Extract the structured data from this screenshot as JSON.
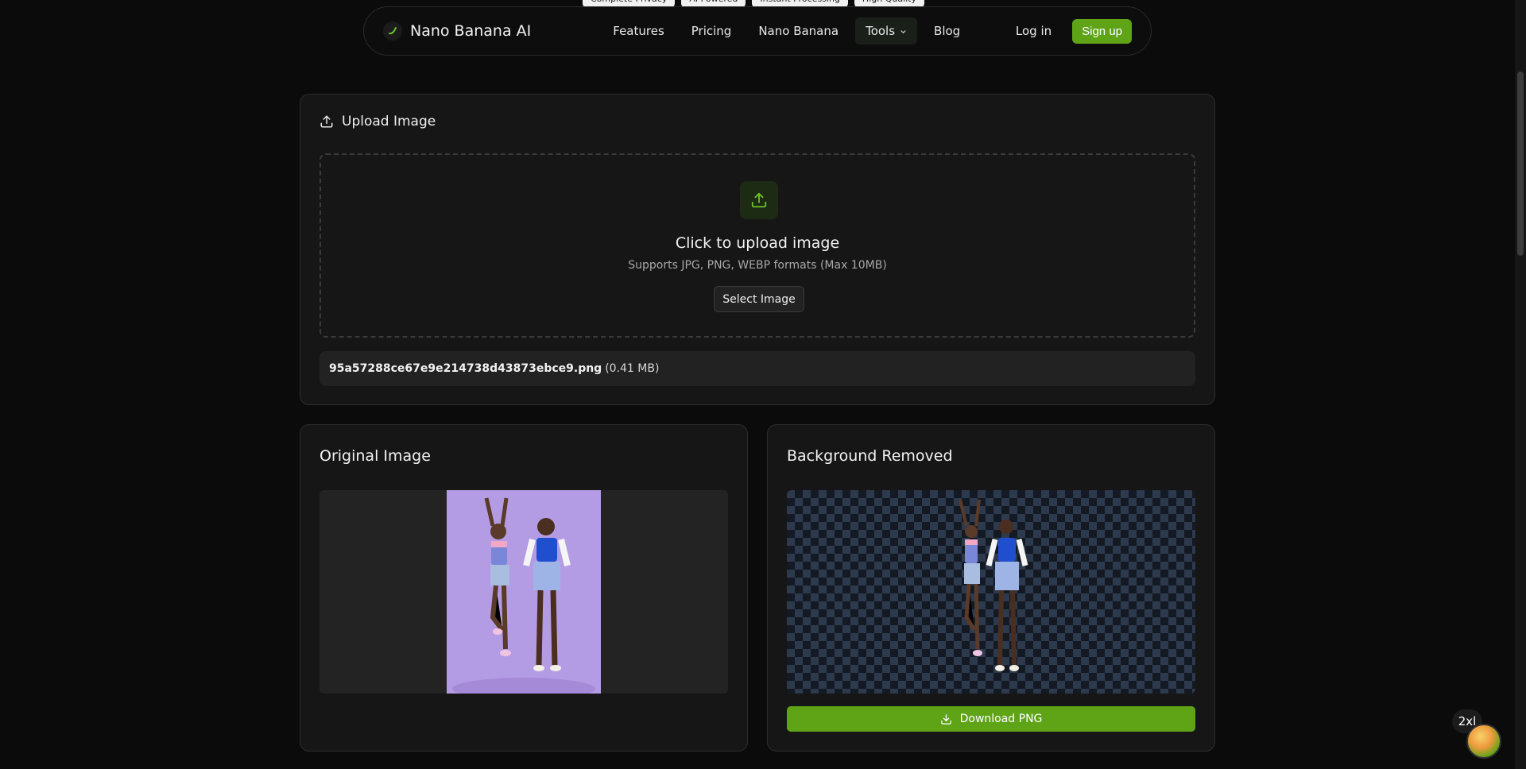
{
  "top_tags": [
    "Complete Privacy",
    "AI Powered",
    "Instant Processing",
    "High Quality"
  ],
  "nav": {
    "brand": "Nano Banana AI",
    "links": [
      "Features",
      "Pricing",
      "Nano Banana",
      "Tools",
      "Blog"
    ],
    "login": "Log in",
    "signup": "Sign up"
  },
  "upload": {
    "header": "Upload Image",
    "dropzone_title": "Click to upload image",
    "dropzone_sub": "Supports JPG, PNG, WEBP formats (Max 10MB)",
    "select_button": "Select Image",
    "file_name": "95a57288ce67e9e214738d43873ebce9.png",
    "file_size": "(0.41 MB)"
  },
  "original": {
    "title": "Original Image"
  },
  "removed": {
    "title": "Background Removed",
    "download": "Download PNG"
  },
  "widgets": {
    "zoom_badge": "2xl"
  },
  "colors": {
    "accent": "#5fa417",
    "background": "#0b0b0b",
    "card": "#161616"
  }
}
